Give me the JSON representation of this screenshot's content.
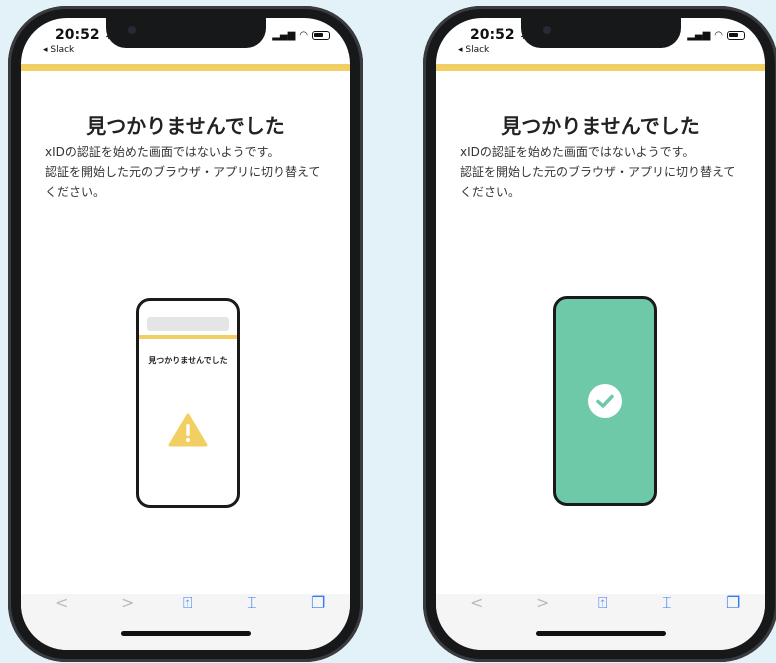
{
  "phones": [
    {
      "status": {
        "time": "20:52 ➶",
        "back_app": "◂ Slack"
      },
      "title": "見つかりませんでした",
      "description": [
        "xIDの認証を始めた画面ではないようです。",
        "認証を開始した元のブラウザ・アプリに切り替えて",
        "ください。"
      ],
      "illustration": {
        "mini_title": "見つかりませんでした",
        "icon": "warning-icon"
      }
    },
    {
      "status": {
        "time": "20:52 ➶",
        "back_app": "◂ Slack"
      },
      "title": "見つかりませんでした",
      "description": [
        "xIDの認証を始めた画面ではないようです。",
        "認証を開始した元のブラウザ・アプリに切り替えて",
        "ください。"
      ],
      "illustration": {
        "icon": "check-icon"
      }
    }
  ],
  "browser_nav": {
    "back": "<",
    "forward": ">",
    "share": "⍐",
    "bookmarks": "⌶",
    "tabs": "❐"
  },
  "colors": {
    "accent_yellow": "#f1cf63",
    "success_green": "#6ec9a8",
    "warning_yellow": "#f1cf63",
    "background": "#e3f1f9"
  }
}
